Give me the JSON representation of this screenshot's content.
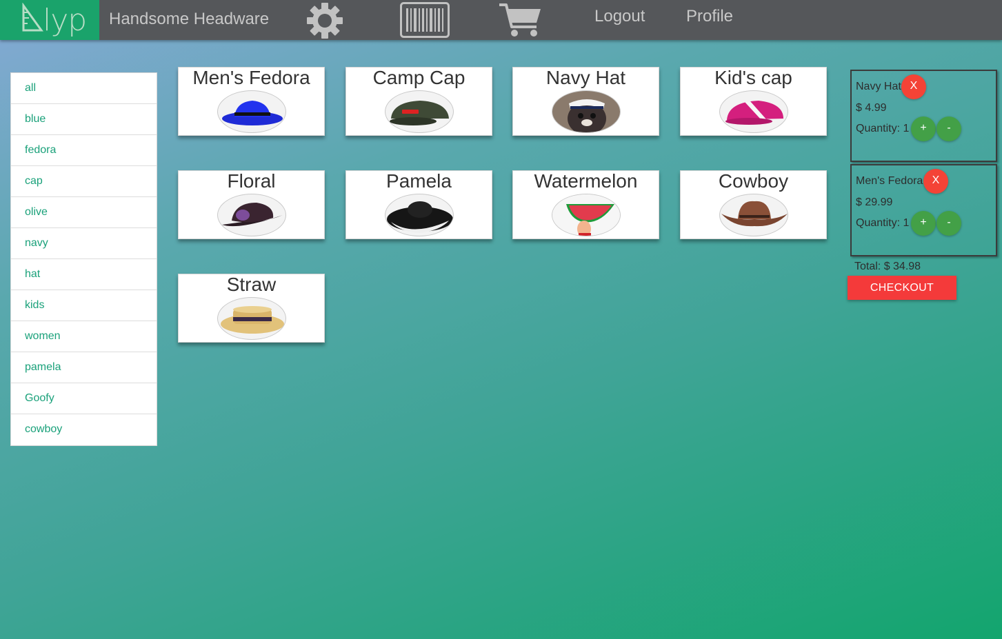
{
  "header": {
    "logo_text": "lyp",
    "store_title": "Handsome Headware",
    "icons": [
      "gear-icon",
      "barcode-icon",
      "cart-icon"
    ],
    "logout_label": "Logout",
    "profile_label": "Profile",
    "colors": {
      "bar": "#55575a",
      "logo_bg": "#1aa36b"
    }
  },
  "filters": [
    "all",
    "blue",
    "fedora",
    "cap",
    "olive",
    "navy",
    "hat",
    "kids",
    "women",
    "pamela",
    "Goofy",
    "cowboy"
  ],
  "products": [
    {
      "name": "Men's Fedora",
      "thumb": "blue-fedora"
    },
    {
      "name": "Camp Cap",
      "thumb": "olive-cap"
    },
    {
      "name": "Navy Hat",
      "thumb": "dog-navy-hat"
    },
    {
      "name": "Kid's cap",
      "thumb": "pink-cap"
    },
    {
      "name": "Floral",
      "thumb": "purple-floral-hat"
    },
    {
      "name": "Pamela",
      "thumb": "black-white-pamela"
    },
    {
      "name": "Watermelon",
      "thumb": "watermelon-hat"
    },
    {
      "name": "Cowboy",
      "thumb": "brown-cowboy"
    },
    {
      "name": "Straw",
      "thumb": "straw-boater"
    }
  ],
  "cart": {
    "items": [
      {
        "name": "Navy Hat",
        "price": "$ 4.99",
        "quantity": "Quantity: 1"
      },
      {
        "name": "Men's Fedora",
        "price": "$ 29.99",
        "quantity": "Quantity: 1"
      }
    ],
    "remove_label": "X",
    "plus_label": "+",
    "minus_label": "-",
    "total": "Total: $ 34.98",
    "checkout_label": "CHECKOUT",
    "colors": {
      "remove": "#f44336",
      "qty": "#43a047",
      "checkout": "#f43a3a"
    }
  }
}
